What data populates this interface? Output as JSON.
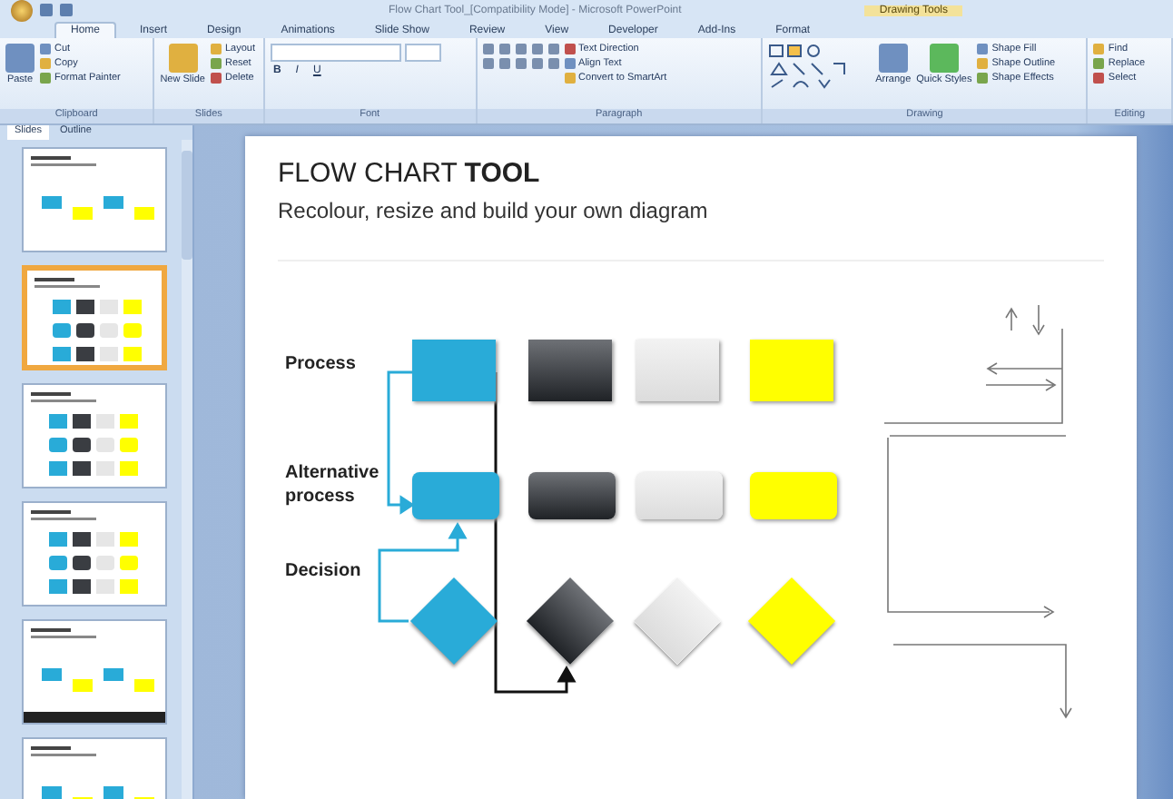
{
  "window": {
    "title": "Flow Chart Tool_[Compatibility Mode] - Microsoft PowerPoint",
    "context_tab": "Drawing Tools"
  },
  "tabs": [
    {
      "label": "Home",
      "selected": true
    },
    {
      "label": "Insert",
      "selected": false
    },
    {
      "label": "Design",
      "selected": false
    },
    {
      "label": "Animations",
      "selected": false
    },
    {
      "label": "Slide Show",
      "selected": false
    },
    {
      "label": "Review",
      "selected": false
    },
    {
      "label": "View",
      "selected": false
    },
    {
      "label": "Developer",
      "selected": false
    },
    {
      "label": "Add-Ins",
      "selected": false
    },
    {
      "label": "Format",
      "selected": false
    }
  ],
  "ribbon": {
    "groups": [
      {
        "label": "Clipboard",
        "big": "Paste",
        "small": [
          "Cut",
          "Copy",
          "Format Painter"
        ]
      },
      {
        "label": "Slides",
        "big": "New Slide",
        "small": [
          "Layout",
          "Reset",
          "Delete"
        ]
      },
      {
        "label": "Font",
        "styles": [
          "B",
          "I",
          "U"
        ]
      },
      {
        "label": "Paragraph",
        "small": [
          "Text Direction",
          "Align Text",
          "Convert to SmartArt"
        ]
      },
      {
        "label": "Drawing",
        "big": "Arrange",
        "big2": "Quick Styles",
        "small": [
          "Shape Fill",
          "Shape Outline",
          "Shape Effects"
        ]
      },
      {
        "label": "Editing",
        "small": [
          "Find",
          "Replace",
          "Select"
        ]
      }
    ]
  },
  "panel": {
    "tabs": [
      {
        "label": "Slides",
        "selected": true
      },
      {
        "label": "Outline",
        "selected": false
      }
    ],
    "thumbnails": [
      {
        "selected": false
      },
      {
        "selected": true
      },
      {
        "selected": false
      },
      {
        "selected": false
      },
      {
        "selected": false
      },
      {
        "selected": false
      }
    ]
  },
  "slide": {
    "title": "FLOW CHART **TOOL**",
    "subtitle": "Recolour, resize and build your own diagram",
    "rows": [
      {
        "label": "Process",
        "kind": "process",
        "shapes": [
          {
            "kind": "blue"
          },
          {
            "kind": "dark"
          },
          {
            "kind": "light"
          },
          {
            "kind": "yellow"
          }
        ]
      },
      {
        "label": "Alternative process",
        "kind": "alternative",
        "shapes": [
          {
            "kind": "blue"
          },
          {
            "kind": "dark"
          },
          {
            "kind": "light"
          },
          {
            "kind": "yellow"
          }
        ]
      },
      {
        "label": "Decision",
        "kind": "decision",
        "shapes": [
          {
            "kind": "blue"
          },
          {
            "kind": "dark"
          },
          {
            "kind": "light"
          },
          {
            "kind": "yellow"
          }
        ]
      }
    ]
  }
}
